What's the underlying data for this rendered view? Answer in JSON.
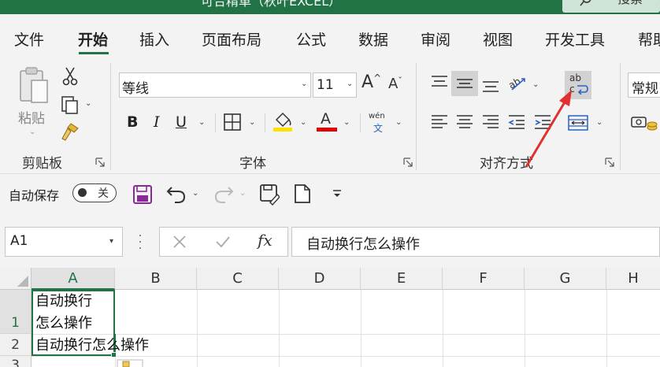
{
  "window": {
    "title": "可合精革（秋叶EXCEL）",
    "search_label": "搜索"
  },
  "tabs": [
    "文件",
    "开始",
    "插入",
    "页面布局",
    "公式",
    "数据",
    "审阅",
    "视图",
    "开发工具",
    "帮助"
  ],
  "ribbon": {
    "clipboard": {
      "label": "剪贴板",
      "paste_label": "粘贴"
    },
    "font": {
      "label": "字体",
      "font_name": "等线",
      "font_size": "11",
      "phonetic_label": "wén",
      "phonetic_char": "文",
      "fill_color": "#ffe000",
      "font_color": "#e00000"
    },
    "alignment": {
      "label": "对齐方式",
      "wrap_text_label": "ab",
      "wrap_text_sub": "c"
    },
    "number": {
      "format": "常规"
    }
  },
  "qat": {
    "autosave_label": "自动保存",
    "toggle_state": "关"
  },
  "formula_bar": {
    "name_box": "A1",
    "fx_label": "fx",
    "formula": "自动换行怎么操作"
  },
  "sheet": {
    "columns": [
      "A",
      "B",
      "C",
      "D",
      "E",
      "F",
      "G",
      "H"
    ],
    "rows": [
      "1",
      "2",
      "3"
    ],
    "cells": {
      "A1_line1": "自动换行",
      "A1_line2": "怎么操作",
      "A2": "自动换行怎么操作"
    }
  },
  "colors": {
    "brand_green": "#217346",
    "annotation_red": "#e03030"
  }
}
